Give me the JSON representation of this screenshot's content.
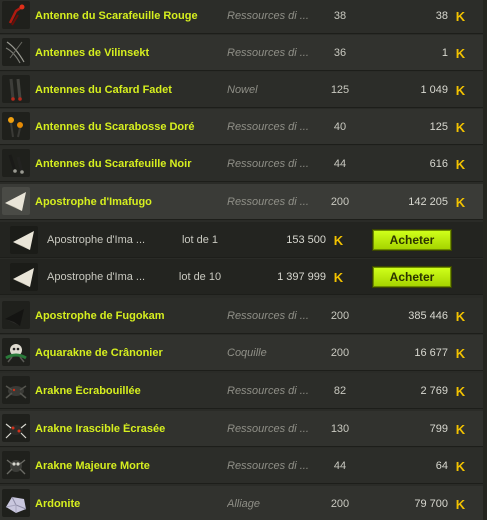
{
  "currency_icon": "kama-icon",
  "buy_color": "#c2f000",
  "name_color": "#d6ef1f",
  "items": [
    {
      "name": "Antenne du Scarafeuille Rouge",
      "category": "Ressources di ...",
      "level": "38",
      "price": "38",
      "icon": "red-antenna-icon"
    },
    {
      "name": "Antennes de Vilinsekt",
      "category": "Ressources di ...",
      "level": "36",
      "price": "1",
      "icon": "thin-antennae-icon"
    },
    {
      "name": "Antennes du Cafard Fadet",
      "category": "Nowel",
      "level": "125",
      "price": "1 049",
      "icon": "cockroach-antennae-icon"
    },
    {
      "name": "Antennes du Scarabosse Doré",
      "category": "Ressources di ...",
      "level": "40",
      "price": "125",
      "icon": "golden-antennae-icon"
    },
    {
      "name": "Antennes du Scarafeuille Noir",
      "category": "Ressources di ...",
      "level": "44",
      "price": "616",
      "icon": "black-antennae-icon"
    },
    {
      "name": "Apostrophe d'Imafugo",
      "category": "Ressources di ...",
      "level": "200",
      "price": "142 205",
      "icon": "white-shard-icon"
    },
    {
      "name": "Apostrophe de Fugokam",
      "category": "Ressources di ...",
      "level": "200",
      "price": "385 446",
      "icon": "dark-shard-icon"
    },
    {
      "name": "Aquarakne de Crânonier",
      "category": "Coquille",
      "level": "200",
      "price": "16 677",
      "icon": "skull-spider-icon"
    },
    {
      "name": "Arakne Écrabouillée",
      "category": "Ressources di ...",
      "level": "82",
      "price": "2 769",
      "icon": "squashed-spider-icon"
    },
    {
      "name": "Arakne Irascible Écrasée",
      "category": "Ressources di ...",
      "level": "130",
      "price": "799",
      "icon": "red-spider-icon"
    },
    {
      "name": "Arakne Majeure Morte",
      "category": "Ressources di ...",
      "level": "44",
      "price": "64",
      "icon": "dead-spider-icon"
    },
    {
      "name": "Ardonite",
      "category": "Alliage",
      "level": "200",
      "price": "79 700",
      "icon": "ore-icon"
    }
  ],
  "offers": [
    {
      "name": "Apostrophe d'Ima ...",
      "lot": "lot de 1",
      "price": "153 500",
      "button": "Acheter"
    },
    {
      "name": "Apostrophe d'Ima ...",
      "lot": "lot de 10",
      "price": "1 397 999",
      "button": "Acheter"
    }
  ]
}
